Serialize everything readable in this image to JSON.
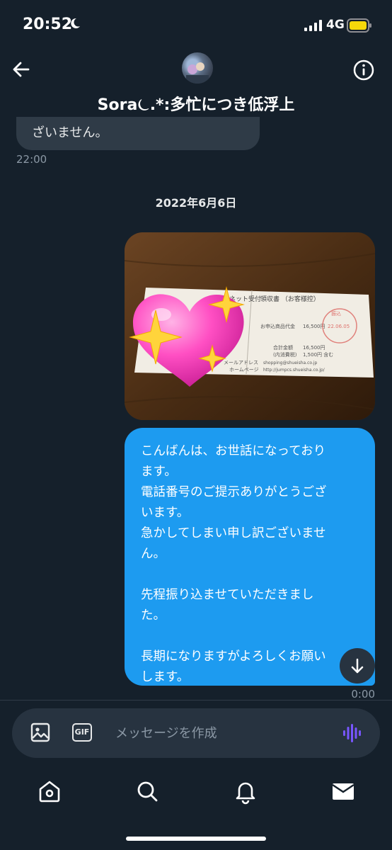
{
  "status_bar": {
    "time": "20:52",
    "network": "4G",
    "icons": [
      "moon-icon",
      "signal-icon",
      "battery-icon"
    ],
    "battery_color": "#f5d90a"
  },
  "header": {
    "contact_name": "Sora⏾.*:多忙につき低浮上",
    "icons": [
      "back-arrow-icon",
      "info-icon"
    ]
  },
  "conversation": {
    "incoming_partial_text": "ざいません。",
    "incoming_timestamp": "22:00",
    "date_separator": "2022年6月6日",
    "photo": {
      "receipt_header": "ネット受付",
      "receipt_title": "領収書 （お客様控）",
      "item_label": "お申込商品代金",
      "item_amount": "16,500円",
      "total_label": "合計金額",
      "total_amount": "16,500円",
      "tax_label": "(内消費税)",
      "tax_amount": "1,500円 含む",
      "mail_label": "メールアドレス",
      "mail_value": "shopping@shueisha.co.jp",
      "homepage_label": "ホームページ",
      "homepage_value": "http://jumpcs.shueisha.co.jp/",
      "stamp_text": "22.06.05",
      "stamp_label": "振込",
      "overlay": "sparkling-heart-emoji"
    },
    "outgoing_lines": [
      "こんばんは、お世話になっており",
      "ます。",
      "電話番号のご提示ありがとうござ",
      "います。",
      "急かしてしまい申し訳ございませ",
      "ん。",
      "",
      "先程振り込ませていただきまし",
      "た。",
      "",
      "長期になりますがよろしくお願い",
      "します。"
    ],
    "outgoing_timestamp": "0:00",
    "outgoing_color": "#1d9bf0"
  },
  "composer": {
    "placeholder": "メッセージを作成",
    "gif_label": "GIF",
    "icons": [
      "image-icon",
      "gif-icon",
      "voice-wave-icon"
    ],
    "voice_color": "#7856ff"
  },
  "tab_bar": {
    "tabs": [
      "home-icon",
      "search-icon",
      "notifications-icon",
      "messages-icon"
    ]
  }
}
